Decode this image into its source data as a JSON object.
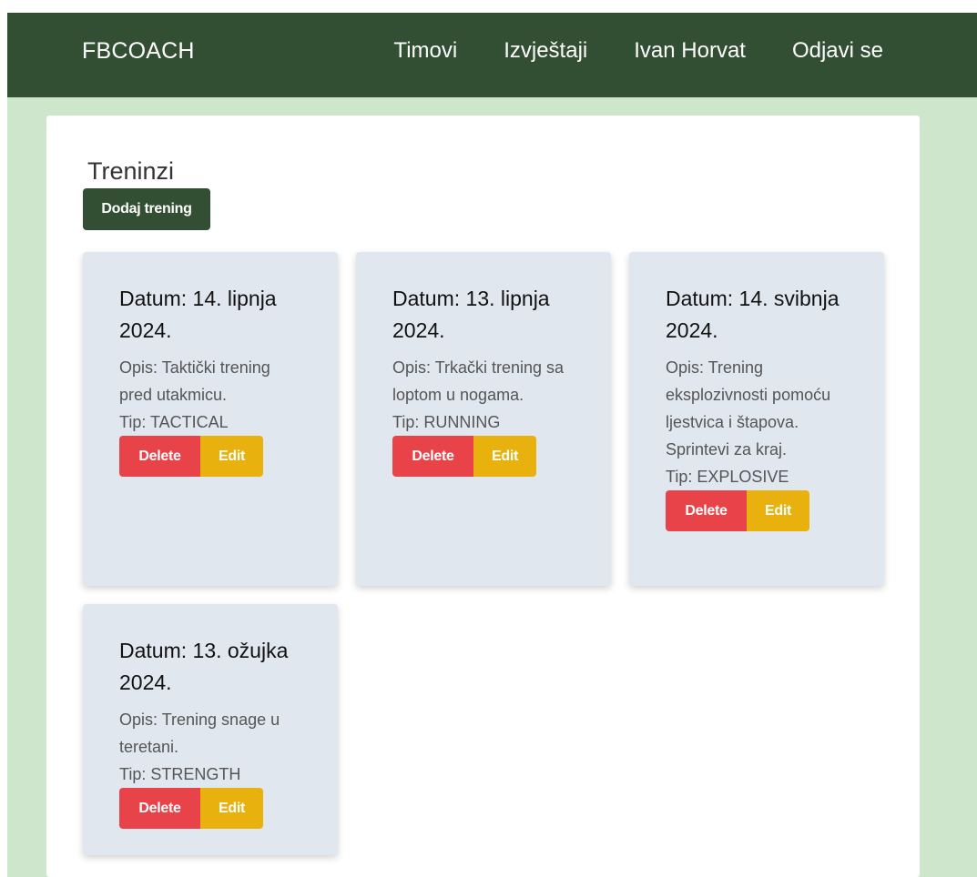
{
  "nav": {
    "brand": "FBCOACH",
    "links": [
      "Timovi",
      "Izvještaji",
      "Ivan Horvat",
      "Odjavi se"
    ]
  },
  "page": {
    "title": "Treninzi",
    "add_button": "Dodaj trening"
  },
  "trainings": [
    {
      "date": "Datum: 14. lipnja 2024.",
      "description": "Opis: Taktički trening pred utakmicu.",
      "type": "Tip: TACTICAL",
      "delete_label": "Delete",
      "edit_label": "Edit"
    },
    {
      "date": "Datum: 13. lipnja 2024.",
      "description": "Opis: Trkački trening sa loptom u nogama.",
      "type": "Tip: RUNNING",
      "delete_label": "Delete",
      "edit_label": "Edit"
    },
    {
      "date": "Datum: 14. svibnja 2024.",
      "description": "Opis: Trening eksplozivnosti pomoću ljestvica i štapova. Sprintevi za kraj.",
      "type": "Tip: EXPLOSIVE",
      "delete_label": "Delete",
      "edit_label": "Edit"
    },
    {
      "date": "Datum: 13. ožujka 2024.",
      "description": "Opis: Trening snage u teretani.",
      "type": "Tip: STRENGTH",
      "delete_label": "Delete",
      "edit_label": "Edit"
    }
  ],
  "colors": {
    "navbar": "#324f33",
    "page_background": "#cde6cc",
    "card_background": "#e1e7ef",
    "delete": "#e9434a",
    "edit": "#e9b10d"
  }
}
